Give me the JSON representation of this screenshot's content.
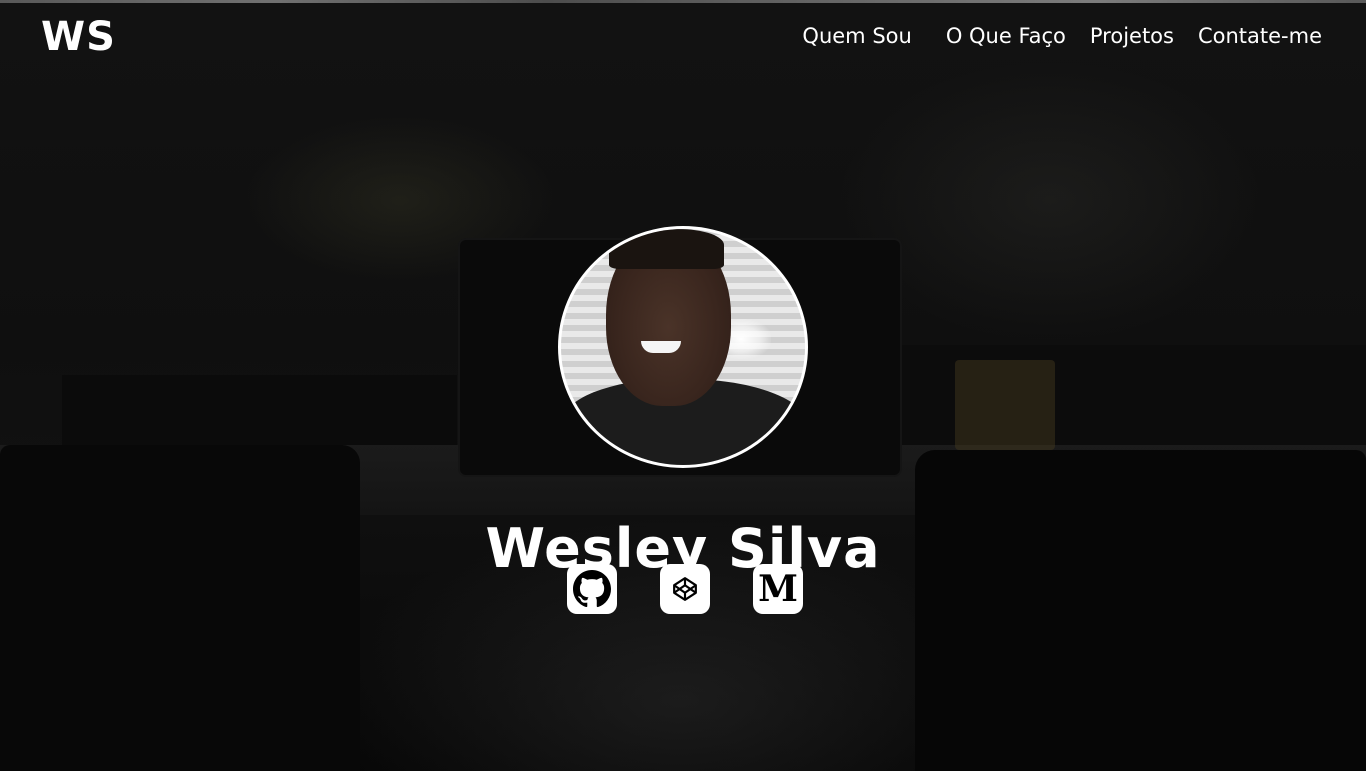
{
  "navbar": {
    "logo": "WS",
    "links": [
      {
        "label": "Quem Sou"
      },
      {
        "label": "O Que Faço"
      },
      {
        "label": "Projetos"
      },
      {
        "label": "Contate-me"
      }
    ]
  },
  "hero": {
    "name": "Wesley Silva",
    "avatar_alt": "profile photo",
    "socials": [
      {
        "icon": "github-icon"
      },
      {
        "icon": "codepen-icon"
      },
      {
        "icon": "medium-icon",
        "glyph": "M"
      }
    ]
  },
  "colors": {
    "text": "#ffffff",
    "background": "#0f0f0f",
    "icon_bg": "#ffffff",
    "icon_fg": "#000000"
  }
}
